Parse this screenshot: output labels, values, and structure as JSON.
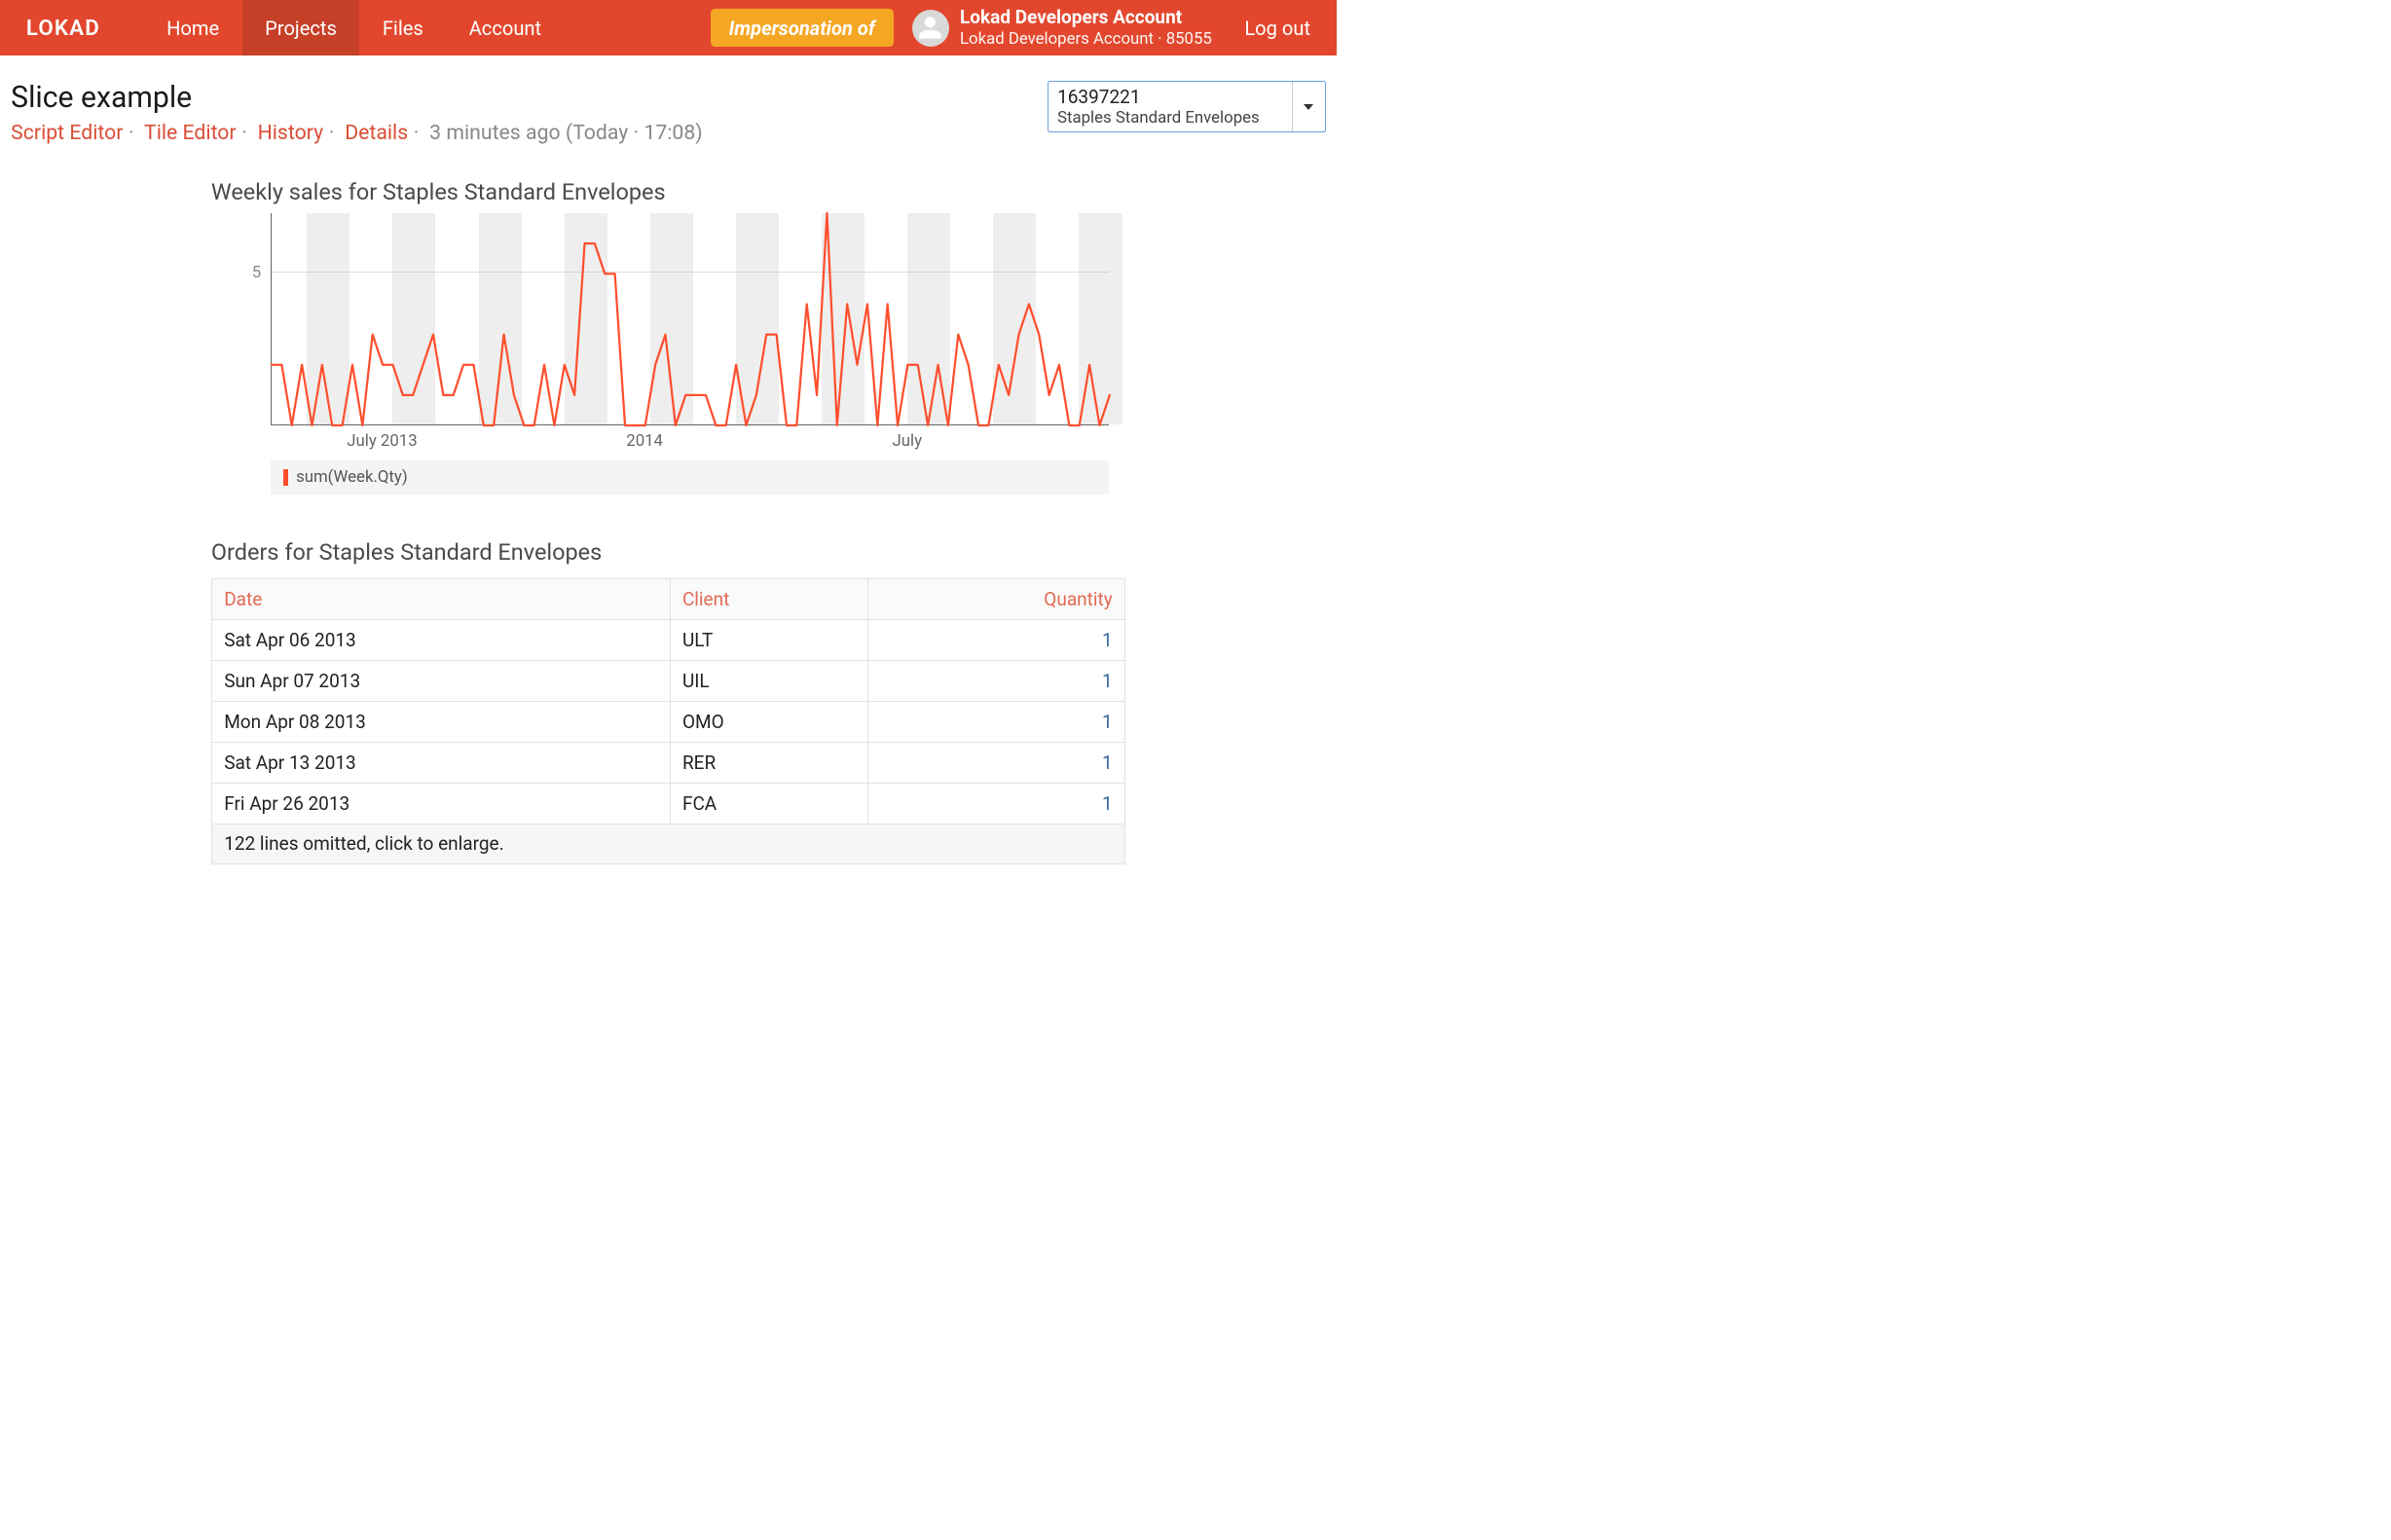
{
  "brand": "LOKAD",
  "nav": {
    "items": [
      {
        "label": "Home",
        "active": false
      },
      {
        "label": "Projects",
        "active": true
      },
      {
        "label": "Files",
        "active": false
      },
      {
        "label": "Account",
        "active": false
      }
    ],
    "impersonation": "Impersonation of",
    "account_name": "Lokad Developers Account",
    "account_sub": "Lokad Developers Account · 85055",
    "logout": "Log out"
  },
  "page": {
    "title": "Slice example",
    "breadcrumbs": [
      "Script Editor",
      "Tile Editor",
      "History",
      "Details"
    ],
    "meta": "3 minutes ago (Today · 17:08)"
  },
  "slice": {
    "id": "16397221",
    "name": "Staples Standard Envelopes"
  },
  "chart": {
    "title": "Weekly sales for Staples Standard Envelopes",
    "legend": "sum(Week.Qty)"
  },
  "orders": {
    "title": "Orders for Staples Standard Envelopes",
    "columns": [
      "Date",
      "Client",
      "Quantity"
    ],
    "rows": [
      {
        "date": "Sat Apr 06 2013",
        "client": "ULT",
        "qty": "1"
      },
      {
        "date": "Sun Apr 07 2013",
        "client": "UIL",
        "qty": "1"
      },
      {
        "date": "Mon Apr 08 2013",
        "client": "OMO",
        "qty": "1"
      },
      {
        "date": "Sat Apr 13 2013",
        "client": "RER",
        "qty": "1"
      },
      {
        "date": "Fri Apr 26 2013",
        "client": "FCA",
        "qty": "1"
      }
    ],
    "omitted": "122 lines omitted, click to enlarge."
  },
  "chart_data": {
    "type": "line",
    "title": "Weekly sales for Staples Standard Envelopes",
    "series_name": "sum(Week.Qty)",
    "ylabel": "",
    "xlabel": "",
    "ylim": [
      0,
      7
    ],
    "yticks": [
      5
    ],
    "xticks_at": [
      11,
      37,
      63
    ],
    "xticks_labels": [
      "July 2013",
      "2014",
      "July"
    ],
    "values": [
      2,
      2,
      0,
      2,
      0,
      2,
      0,
      0,
      2,
      0,
      3,
      2,
      2,
      1,
      1,
      2,
      3,
      1,
      1,
      2,
      2,
      0,
      0,
      3,
      1,
      0,
      0,
      2,
      0,
      2,
      1,
      6,
      6,
      5,
      5,
      0,
      0,
      0,
      2,
      3,
      0,
      1,
      1,
      1,
      0,
      0,
      2,
      0,
      1,
      3,
      3,
      0,
      0,
      4,
      1,
      7,
      0,
      4,
      2,
      4,
      0,
      4,
      0,
      2,
      2,
      0,
      2,
      0,
      3,
      2,
      0,
      0,
      2,
      1,
      3,
      4,
      3,
      1,
      2,
      0,
      0,
      2,
      0,
      1
    ],
    "band_width_weeks": 4.3,
    "band_starts": [
      3.5,
      12.1,
      20.7,
      29.3,
      37.9,
      46.5,
      55.1,
      63.7,
      72.3,
      80.9
    ]
  }
}
